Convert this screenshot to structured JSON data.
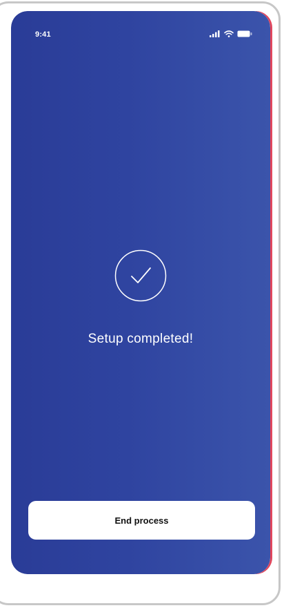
{
  "status_bar": {
    "time": "9:41",
    "icons": [
      "signal-icon",
      "wifi-icon",
      "battery-icon"
    ]
  },
  "success": {
    "icon": "checkmark-icon",
    "title": "Setup completed!"
  },
  "actions": {
    "end_label": "End process"
  },
  "colors": {
    "background_start": "#2a3c97",
    "background_end": "#3b54ab",
    "button_bg": "#ffffff",
    "accent_edge": "#e0465c"
  }
}
